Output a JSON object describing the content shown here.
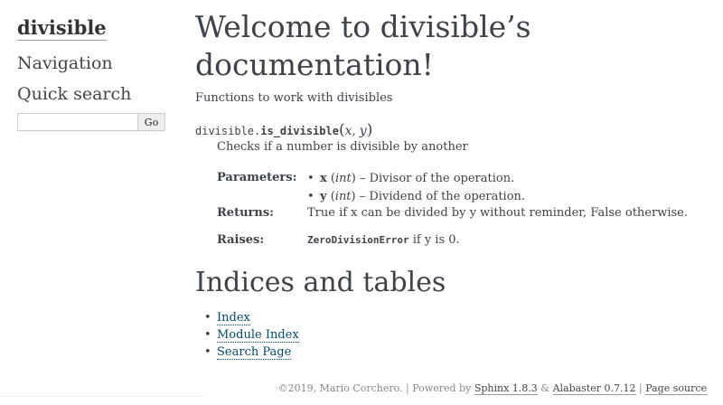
{
  "sidebar": {
    "logo": "divisible",
    "navigation_title": "Navigation",
    "search_title": "Quick search",
    "search_input_value": "",
    "search_button": "Go"
  },
  "main": {
    "title": "Welcome to divisible’s documentation!",
    "intro": "Functions to work with divisibles",
    "signature": {
      "module": "divisible.",
      "name": "is_divisible",
      "open_paren": "(",
      "arg1": "x",
      "sep": ", ",
      "arg2": "y",
      "close_paren": ")"
    },
    "description": "Checks if a number is divisible by another",
    "fields": {
      "parameters_label": "Parameters:",
      "params": [
        {
          "name": "x",
          "type": "int",
          "desc": " – Divisor of the operation."
        },
        {
          "name": "y",
          "type": "int",
          "desc": " – Dividend of the operation."
        }
      ],
      "returns_label": "Returns:",
      "returns_text": "True if x can be divided by y without reminder, False otherwise.",
      "raises_label": "Raises:",
      "raises_exception": "ZeroDivisionError",
      "raises_text": " if y is 0."
    },
    "indices_title": "Indices and tables",
    "indices_links": [
      "Index",
      "Module Index",
      "Search Page"
    ]
  },
  "footer": {
    "copyright": "©2019, Mario Corchero. | Powered by ",
    "sphinx": "Sphinx 1.8.3",
    "amp": " & ",
    "alabaster": "Alabaster 0.7.12",
    "sep": " | ",
    "page_source": "Page source"
  }
}
